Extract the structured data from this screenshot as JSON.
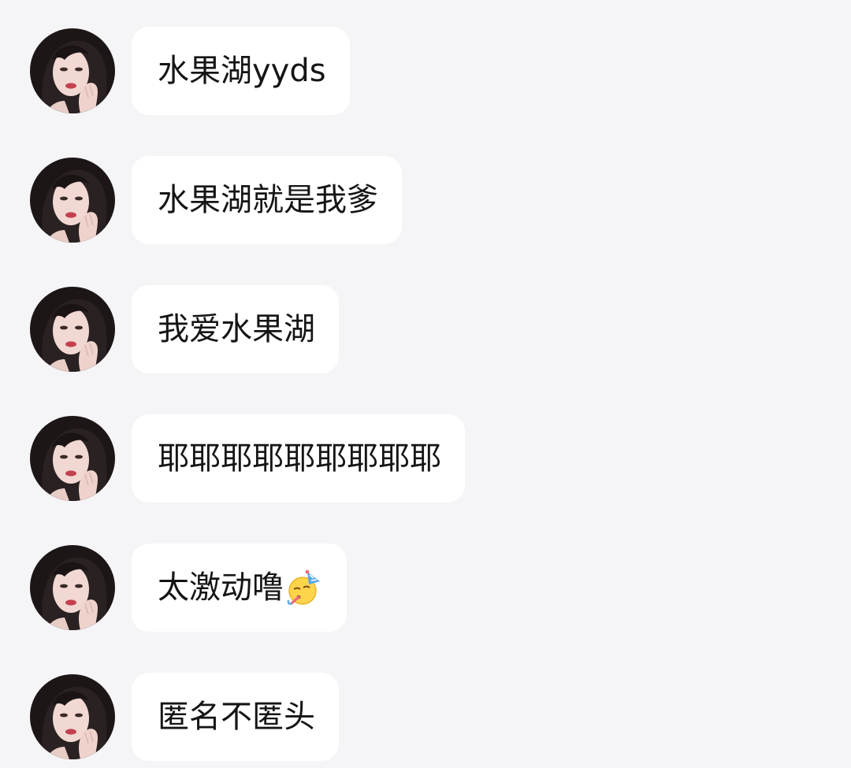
{
  "messages": [
    {
      "text": "水果湖yyds",
      "avatar_icon": "avatar-icon"
    },
    {
      "text": "水果湖就是我爹",
      "avatar_icon": "avatar-icon"
    },
    {
      "text": "我爱水果湖",
      "avatar_icon": "avatar-icon"
    },
    {
      "text": "耶耶耶耶耶耶耶耶耶",
      "avatar_icon": "avatar-icon"
    },
    {
      "text": "太激动噜",
      "emoji": "party-face-emoji",
      "avatar_icon": "avatar-icon"
    },
    {
      "text": "匿名不匿头",
      "avatar_icon": "avatar-icon"
    }
  ],
  "colors": {
    "background": "#f5f4f6",
    "bubble": "#ffffff",
    "text": "#151515"
  }
}
